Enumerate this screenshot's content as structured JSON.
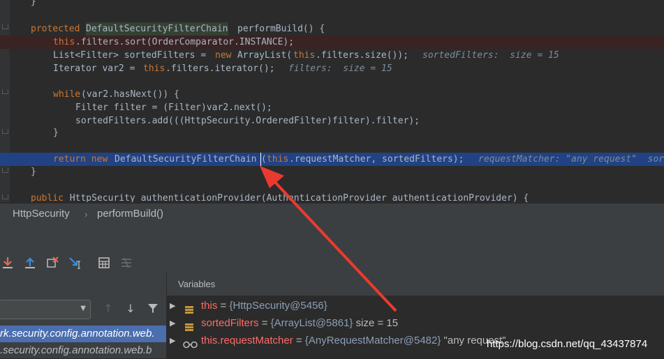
{
  "editor": {
    "lines": {
      "l0": "}",
      "l1_kw": "protected",
      "l1_type": "DefaultSecurityFilterChain",
      "l1_rest": "performBuild() {",
      "l2_this": "this",
      "l2_rest": ".filters.sort(OrderComparator.INSTANCE);",
      "l3_a": "List<Filter> sortedFilters = ",
      "l3_new": "new",
      "l3_b": " ArrayList(",
      "l3_this": "this",
      "l3_c": ".filters.size());",
      "l3_hint": "sortedFilters:  size = 15",
      "l4_a": "Iterator var2 = ",
      "l4_this": "this",
      "l4_b": ".filters.iterator();",
      "l4_hint": "filters:  size = 15",
      "l5_kw": "while",
      "l5_rest": "(var2.hasNext()) {",
      "l6": "Filter filter = (Filter)var2.next();",
      "l7": "sortedFilters.add(((HttpSecurity.OrderedFilter)filter).filter);",
      "l8": "}",
      "l9_kw": "return new",
      "l9_type": "DefaultSecurityFilterChain",
      "l9_this": "this",
      "l9_rest": ".requestMatcher, sortedFilters);",
      "l9_hint": "requestMatcher: \"any request\"  sor",
      "l10": "}",
      "l11_kw": "public",
      "l11_rest": " HttpSecurity authenticationProvider(AuthenticationProvider authenticationProvider) {"
    }
  },
  "breadcrumb": {
    "class": "HttpSecurity",
    "separator": "›",
    "method": "performBuild()"
  },
  "toolbar": {
    "icons": [
      "step-into-icon",
      "step-out-icon",
      "drop-frame-icon",
      "run-to-cursor-icon",
      "evaluate-icon",
      "trace-icon"
    ]
  },
  "frames": {
    "rows": [
      "rk.security.config.annotation.web.",
      ".security.config.annotation.web.b"
    ]
  },
  "variables": {
    "header": "Variables",
    "items": [
      {
        "name": "this",
        "eq": " = ",
        "value": "{HttpSecurity@5456}",
        "extra": ""
      },
      {
        "name": "sortedFilters",
        "eq": " = ",
        "value": "{ArrayList@5861}",
        "extra": " size = 15"
      },
      {
        "name": "this.requestMatcher",
        "eq": " = ",
        "value": "{AnyRequestMatcher@5482}",
        "extra": " \"any request\""
      }
    ]
  },
  "watermark": "https://blog.csdn.net/qq_43437874",
  "colors": {
    "arrow": "#ea3a2f",
    "selection": "#214283",
    "frame_selection": "#4b6eaf"
  }
}
